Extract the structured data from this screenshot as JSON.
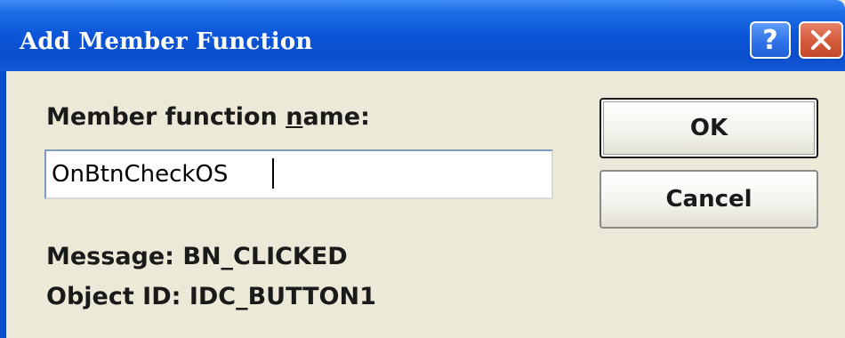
{
  "window": {
    "title": "Add Member Function",
    "help_glyph": "?",
    "help_icon": "help-icon",
    "close_icon": "close-icon"
  },
  "form": {
    "name_label_pre": "Member function ",
    "name_label_underlined": "n",
    "name_label_post": "ame:",
    "name_value": "OnBtnCheckOS",
    "message_label": "Message: BN_CLICKED",
    "object_label": "Object ID: IDC_BUTTON1"
  },
  "buttons": {
    "ok_label": "OK",
    "cancel_label": "Cancel"
  },
  "colors": {
    "titlebar": "#0a4ecc",
    "dialog_face": "#ece9d8",
    "close_button": "#d45a3a"
  }
}
